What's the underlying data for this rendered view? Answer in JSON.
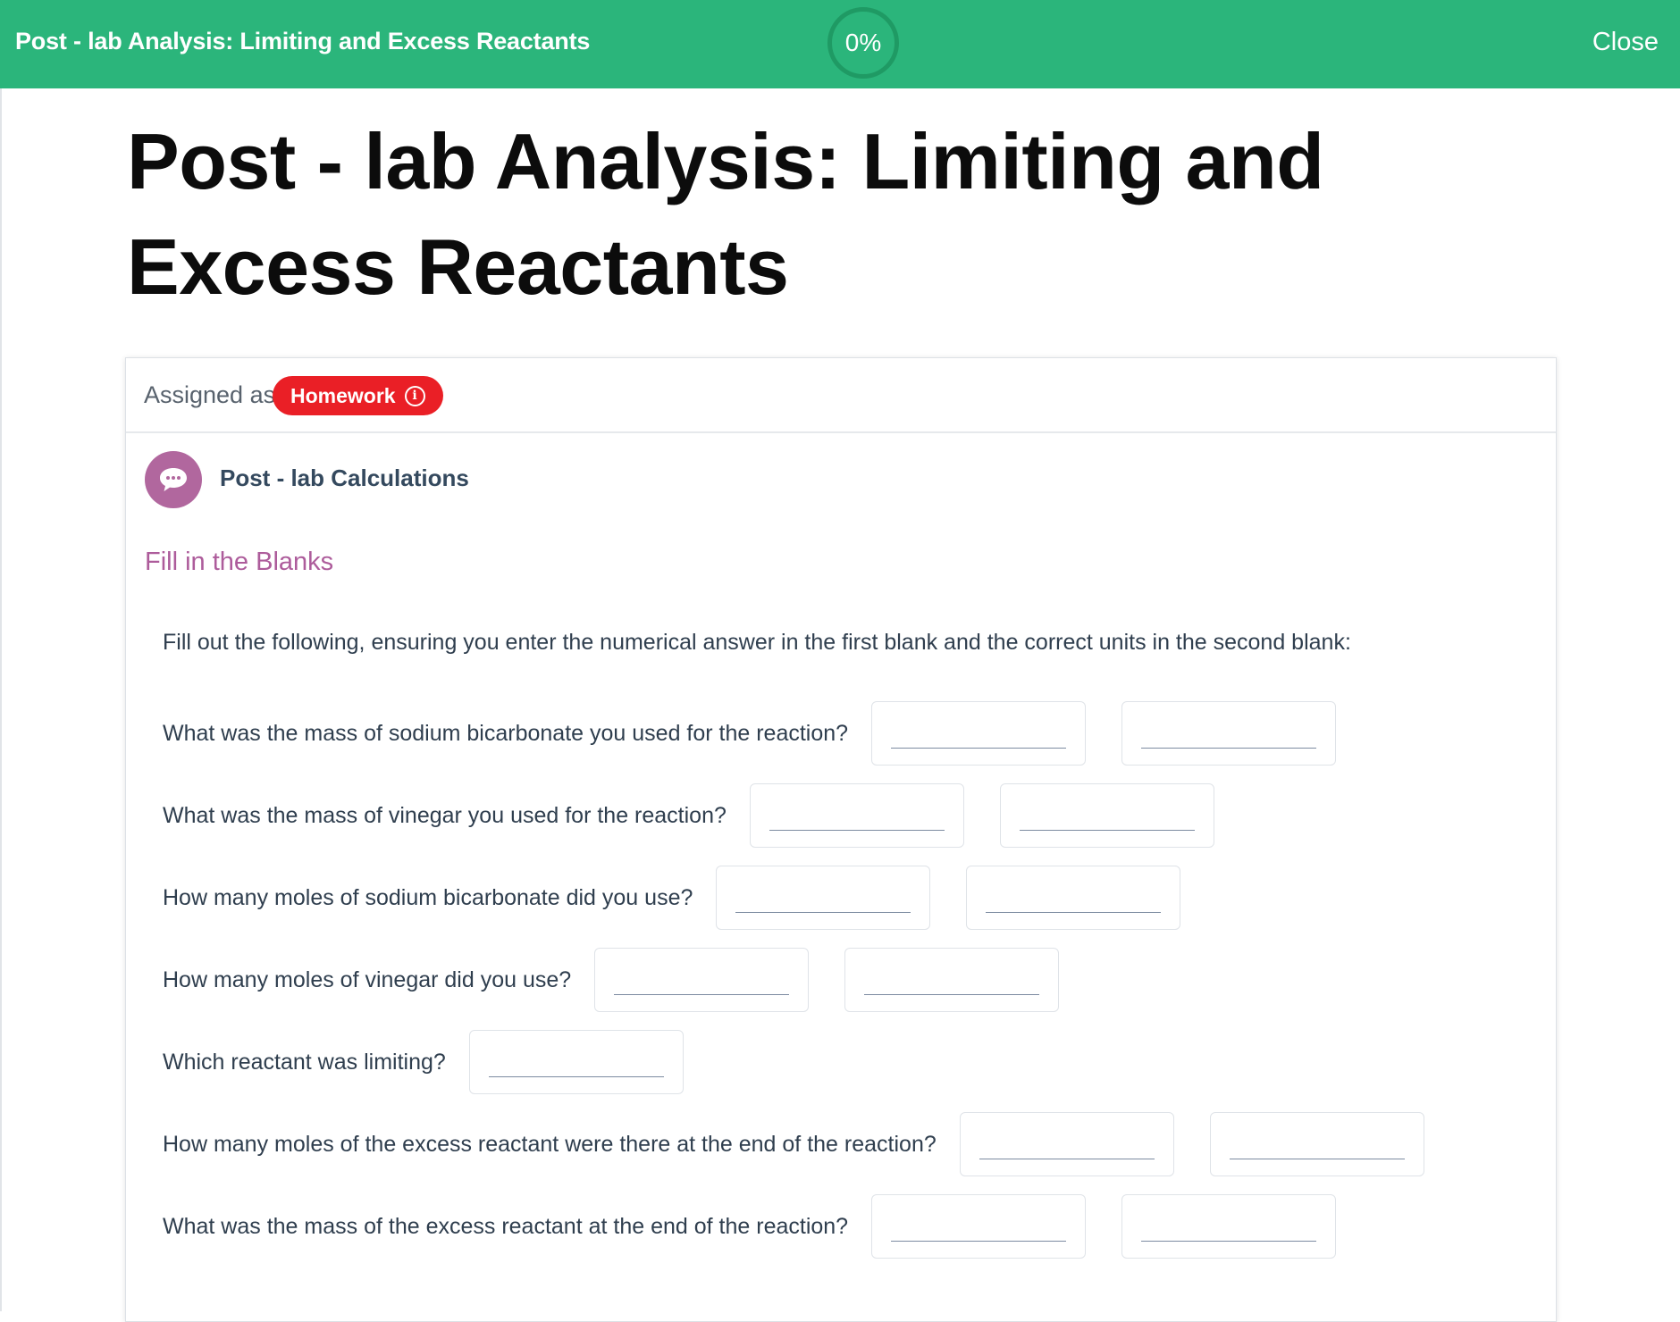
{
  "topbar": {
    "title": "Post - lab Analysis: Limiting and Excess Reactants",
    "progress": "0%",
    "close_label": "Close",
    "background_color": "#2bb57b"
  },
  "page": {
    "title": "Post - lab Analysis: Limiting and Excess Reactants"
  },
  "card": {
    "assigned_label": "Assigned as",
    "badge_label": "Homework",
    "badge_color": "#ea1f26",
    "section_title": "Post - lab Calculations",
    "section_icon": "speech-bubble-icon",
    "fill_heading": "Fill in the Blanks",
    "instructions": "Fill out the following, ensuring you enter the numerical answer in the first blank and the correct units in the second blank:"
  },
  "questions": [
    {
      "text": "What was the mass of sodium bicarbonate you used for the reaction?",
      "blanks": 2
    },
    {
      "text": "What was the mass of vinegar you used for the reaction?",
      "blanks": 2
    },
    {
      "text": "How many moles of sodium bicarbonate did you use?",
      "blanks": 2
    },
    {
      "text": "How many moles of vinegar did you use?",
      "blanks": 2
    },
    {
      "text": "Which reactant was limiting?",
      "blanks": 1
    },
    {
      "text": "How many moles of the excess reactant were there at the end of the reaction?",
      "blanks": 2
    },
    {
      "text": "What was the mass of the excess reactant at the end of the reaction?",
      "blanks": 2
    }
  ]
}
